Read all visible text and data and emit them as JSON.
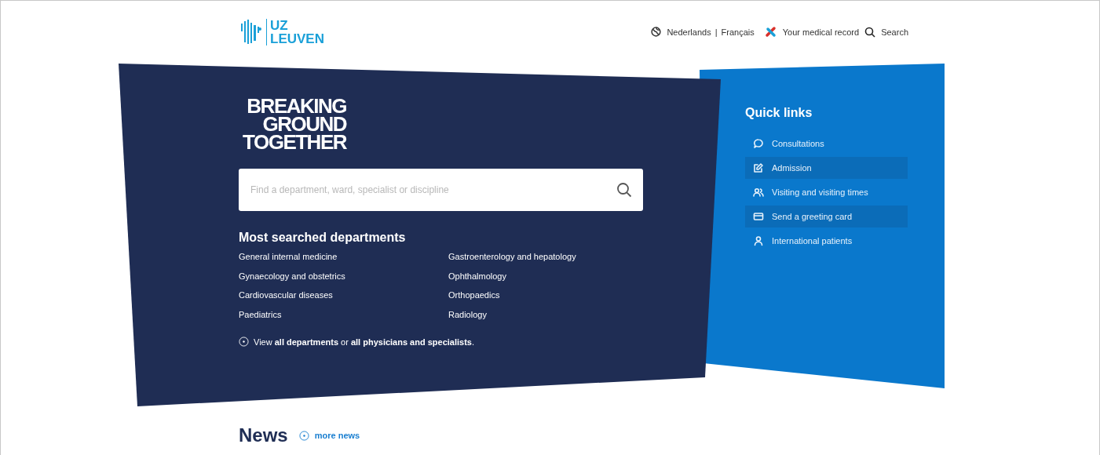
{
  "header": {
    "logo": {
      "line_1": "UZ",
      "line_2": "LEUVEN"
    },
    "languages": [
      {
        "label": "Nederlands"
      },
      {
        "label": "Français"
      }
    ],
    "separator": "|",
    "medical_record": "Your medical record",
    "search": "Search"
  },
  "hero": {
    "tagline": [
      "BREAKING",
      "GROUND",
      "TOGETHER"
    ],
    "search": {
      "placeholder": "Find a department, ward, specialist or discipline"
    },
    "departments_title": "Most searched departments",
    "departments": [
      {
        "label": "General internal medicine"
      },
      {
        "label": "Gastroenterology and hepatology"
      },
      {
        "label": "Gynaecology and obstetrics"
      },
      {
        "label": "Ophthalmology"
      },
      {
        "label": "Cardiovascular diseases"
      },
      {
        "label": "Orthopaedics"
      },
      {
        "label": "Paediatrics"
      },
      {
        "label": "Radiology"
      }
    ],
    "view_all": "View **all departments** or **all physicians and specialists**."
  },
  "quick_links": {
    "title": "Quick links",
    "items": [
      {
        "label": "Consultations",
        "kind": "chat",
        "highlighted": false
      },
      {
        "label": "Admission",
        "kind": "edit",
        "highlighted": true
      },
      {
        "label": "Visiting and visiting times",
        "kind": "people",
        "highlighted": false
      },
      {
        "label": "Send a greeting card",
        "kind": "card",
        "highlighted": true
      },
      {
        "label": "International patients",
        "kind": "person",
        "highlighted": false
      }
    ]
  },
  "news": {
    "title": "News",
    "more": "more news"
  }
}
